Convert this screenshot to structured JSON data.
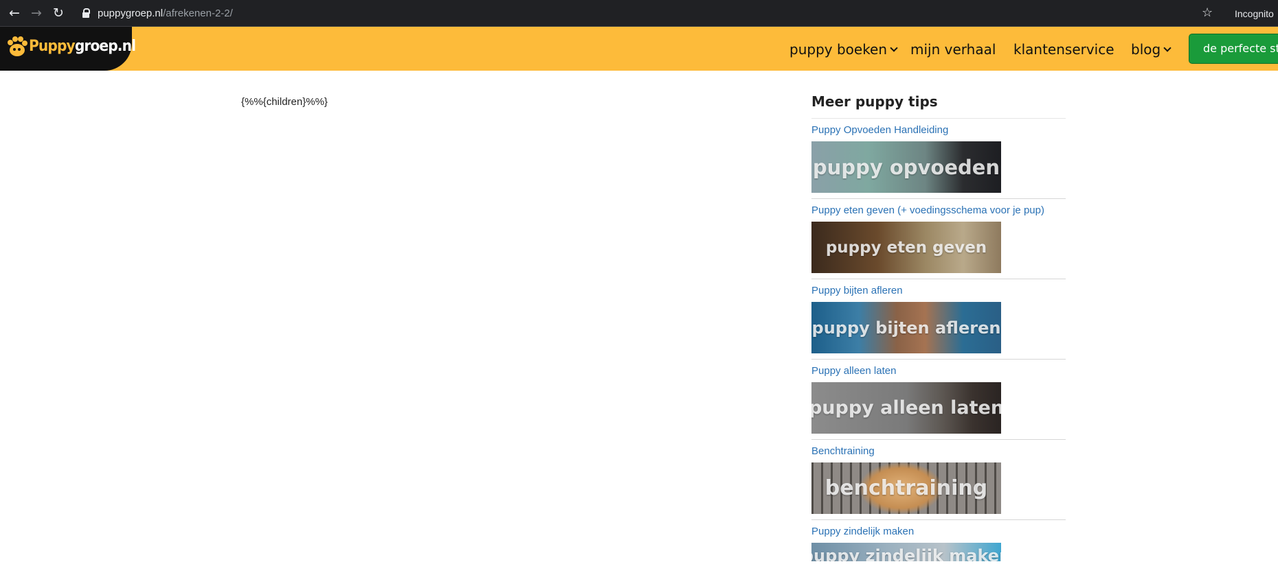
{
  "browser": {
    "url_host": "puppygroep.nl",
    "url_path": "/afrekenen-2-2/",
    "profile_label": "Incognito"
  },
  "header": {
    "logo": {
      "part1": "Puppy",
      "part2": "groep.nl"
    },
    "nav": [
      {
        "label": "puppy boeken",
        "has_dropdown": true
      },
      {
        "label": "mijn verhaal",
        "has_dropdown": false
      },
      {
        "label": "klantenservice",
        "has_dropdown": false
      },
      {
        "label": "blog",
        "has_dropdown": true
      }
    ],
    "cta_label": "de perfecte start",
    "colors": {
      "header_bg": "#fdbb3a",
      "cta_bg": "#1a9b3a",
      "link": "#2b72b5"
    }
  },
  "main": {
    "placeholder_text": "{%%{children}%%}"
  },
  "sidebar": {
    "title": "Meer puppy tips",
    "items": [
      {
        "link": "Puppy Opvoeden Handleiding",
        "image_caption": "puppy opvoeden"
      },
      {
        "link": "Puppy eten geven (+ voedingsschema voor je pup)",
        "image_caption": "puppy eten geven"
      },
      {
        "link": "Puppy bijten afleren",
        "image_caption": "puppy bijten afleren"
      },
      {
        "link": "Puppy alleen laten",
        "image_caption": "puppy alleen laten"
      },
      {
        "link": "Benchtraining",
        "image_caption": "benchtraining"
      },
      {
        "link": "Puppy zindelijk maken",
        "image_caption": "puppy zindelijk maken"
      }
    ]
  }
}
